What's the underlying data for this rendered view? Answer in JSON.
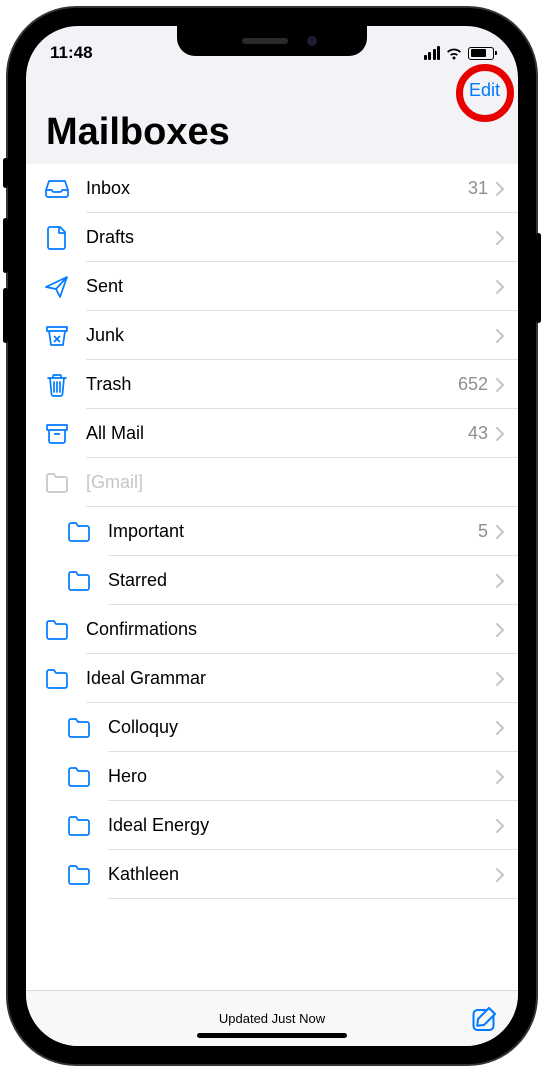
{
  "status": {
    "time": "11:48"
  },
  "nav": {
    "edit_label": "Edit"
  },
  "title": "Mailboxes",
  "mailboxes": [
    {
      "icon": "inbox",
      "label": "Inbox",
      "count": "31",
      "indent": 0,
      "interactive": true
    },
    {
      "icon": "draft",
      "label": "Drafts",
      "count": "",
      "indent": 0,
      "interactive": true
    },
    {
      "icon": "sent",
      "label": "Sent",
      "count": "",
      "indent": 0,
      "interactive": true
    },
    {
      "icon": "junk",
      "label": "Junk",
      "count": "",
      "indent": 0,
      "interactive": true
    },
    {
      "icon": "trash",
      "label": "Trash",
      "count": "652",
      "indent": 0,
      "interactive": true
    },
    {
      "icon": "archive",
      "label": "All Mail",
      "count": "43",
      "indent": 0,
      "interactive": true
    },
    {
      "icon": "folder-gray",
      "label": "[Gmail]",
      "count": "",
      "indent": 0,
      "interactive": false
    },
    {
      "icon": "folder",
      "label": "Important",
      "count": "5",
      "indent": 1,
      "interactive": true
    },
    {
      "icon": "folder",
      "label": "Starred",
      "count": "",
      "indent": 1,
      "interactive": true
    },
    {
      "icon": "folder",
      "label": "Confirmations",
      "count": "",
      "indent": 0,
      "interactive": true
    },
    {
      "icon": "folder",
      "label": "Ideal Grammar",
      "count": "",
      "indent": 0,
      "interactive": true
    },
    {
      "icon": "folder",
      "label": "Colloquy",
      "count": "",
      "indent": 1,
      "interactive": true
    },
    {
      "icon": "folder",
      "label": "Hero",
      "count": "",
      "indent": 1,
      "interactive": true
    },
    {
      "icon": "folder",
      "label": "Ideal Energy",
      "count": "",
      "indent": 1,
      "interactive": true
    },
    {
      "icon": "folder",
      "label": "Kathleen",
      "count": "",
      "indent": 1,
      "interactive": true
    }
  ],
  "toolbar": {
    "status": "Updated Just Now"
  },
  "colors": {
    "accent": "#007aff",
    "gray": "#c6c6c8"
  }
}
